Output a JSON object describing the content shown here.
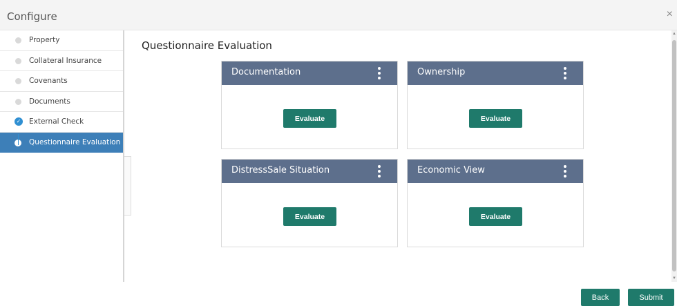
{
  "header": {
    "title": "Configure",
    "close_glyph": "×"
  },
  "sidebar": {
    "items": [
      {
        "label": "Property",
        "state": "pending"
      },
      {
        "label": "Collateral Insurance",
        "state": "pending"
      },
      {
        "label": "Covenants",
        "state": "pending"
      },
      {
        "label": "Documents",
        "state": "pending"
      },
      {
        "label": "External Check",
        "state": "done"
      },
      {
        "label": "Questionnaire Evaluation",
        "state": "active"
      }
    ]
  },
  "main": {
    "section_title": "Questionnaire Evaluation",
    "cards": [
      {
        "title": "Documentation",
        "button_label": "Evaluate"
      },
      {
        "title": "Ownership",
        "button_label": "Evaluate"
      },
      {
        "title": "DistressSale Situation",
        "button_label": "Evaluate"
      },
      {
        "title": "Economic View",
        "button_label": "Evaluate"
      }
    ]
  },
  "footer": {
    "back_label": "Back",
    "submit_label": "Submit"
  },
  "colors": {
    "accent": "#1f7a6b",
    "card_header": "#5d6f8c",
    "active_nav": "#3d7fb8",
    "check": "#2f8fd2"
  },
  "icons": {
    "close": "close-icon",
    "menu": "kebab-menu-icon",
    "done": "check-circle-icon"
  }
}
